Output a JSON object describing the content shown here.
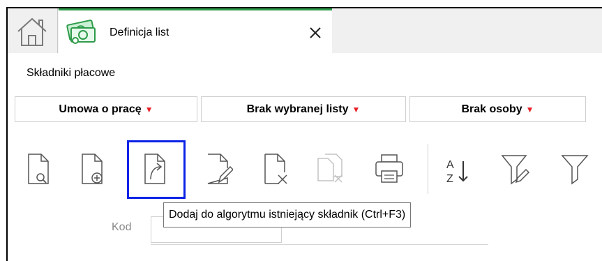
{
  "tabs": {
    "home_icon": "home-icon",
    "active_tab": {
      "icon": "money-icon",
      "title": "Definicja list",
      "close_icon": "close-icon"
    }
  },
  "section": {
    "title": "Składniki płacowe"
  },
  "filters": [
    {
      "label": "Umowa o pracę"
    },
    {
      "label": "Brak wybranej listy"
    },
    {
      "label": "Brak osoby"
    }
  ],
  "toolbar": {
    "buttons": [
      {
        "icon": "preview-document-icon"
      },
      {
        "icon": "add-document-icon"
      },
      {
        "icon": "add-to-algorithm-icon",
        "highlighted": true
      },
      {
        "icon": "edit-document-icon"
      },
      {
        "icon": "delete-document-icon"
      },
      {
        "icon": "copy-document-icon",
        "disabled": true
      },
      {
        "icon": "print-icon"
      },
      {
        "icon": "sort-az-icon"
      },
      {
        "icon": "filter-edit-icon"
      },
      {
        "icon": "filter-icon"
      }
    ],
    "tooltip": "Dodaj do algorytmu istniejący składnik  (Ctrl+F3)"
  },
  "form": {
    "kod_label": "Kod",
    "kod_value": ""
  },
  "colors": {
    "accent_green": "#2e9b4a",
    "caret_red": "#e8202a",
    "focus_blue": "#0a24e6"
  }
}
